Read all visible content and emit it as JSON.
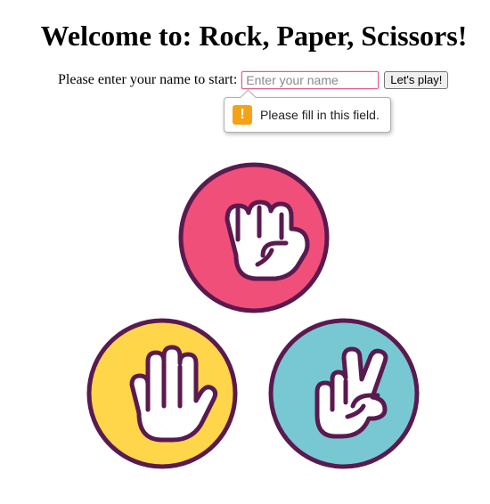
{
  "page": {
    "title": "Welcome to: Rock, Paper, Scissors!"
  },
  "form": {
    "label": "Please enter your name to start:",
    "name_placeholder": "Enter your name",
    "name_value": "",
    "play_button_label": "Let's play!"
  },
  "validation": {
    "icon": "warning-icon",
    "message": "Please fill in this field."
  },
  "choices": [
    {
      "id": "rock",
      "icon": "fist-icon",
      "color": "#f04f7a"
    },
    {
      "id": "paper",
      "icon": "open-hand-icon",
      "color": "#ffd54a"
    },
    {
      "id": "scissors",
      "icon": "peace-hand-icon",
      "color": "#78c8d4"
    }
  ],
  "colors": {
    "outline": "#5a1a4f",
    "hand_fill": "#ffffff",
    "input_focus": "#e0608a",
    "warning": "#f4a316"
  }
}
